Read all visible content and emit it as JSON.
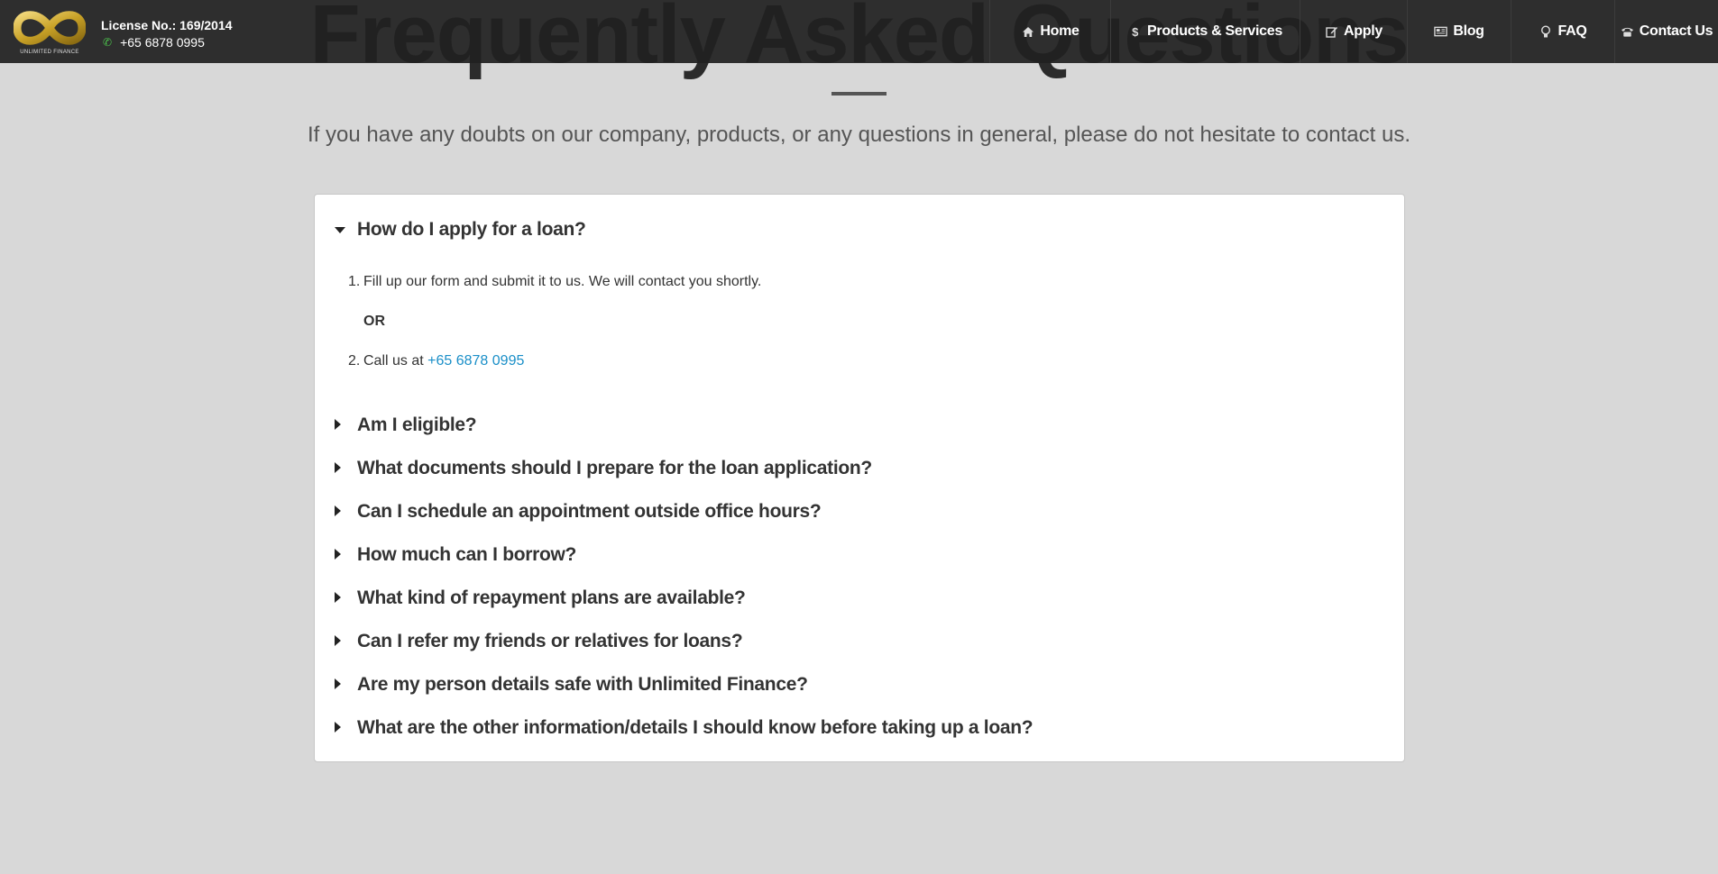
{
  "header": {
    "title": "Frequently Asked Questions",
    "subtitle": "If you have any doubts on our company, products, or any questions in general, please do not hesitate to contact us."
  },
  "navbar": {
    "logo_text": "UNLIMITED FINANCE",
    "license": "License No.: 169/2014",
    "phone": "+65 6878 0995",
    "brand_gold": "#c9a227",
    "items": [
      {
        "label": "Home",
        "icon": "home-icon"
      },
      {
        "label": "Products & Services",
        "icon": "dollar-icon"
      },
      {
        "label": "Apply",
        "icon": "edit-icon"
      },
      {
        "label": "Blog",
        "icon": "newspaper-icon"
      },
      {
        "label": "FAQ",
        "icon": "lightbulb-icon"
      },
      {
        "label": "Contact Us",
        "icon": "phone-icon"
      }
    ]
  },
  "faq": {
    "open_question": "How do I apply for a loan?",
    "answer": {
      "step1": "Fill up our form and submit it to us. We will contact you shortly.",
      "or": "OR",
      "step2_prefix": "Call us at ",
      "step2_link": "+65 6878 0995",
      "num1": "1.",
      "num2": "2."
    },
    "questions": [
      "Am I eligible?",
      "What documents should I prepare for the loan application?",
      "Can I schedule an appointment outside office hours?",
      "How much can I borrow?",
      "What kind of repayment plans are available?",
      "Can I refer my friends or relatives for loans?",
      "Are my person details safe with Unlimited Finance?",
      "What are the other information/details I should know before taking up a loan?"
    ],
    "link_color": "#1a8fc8"
  }
}
